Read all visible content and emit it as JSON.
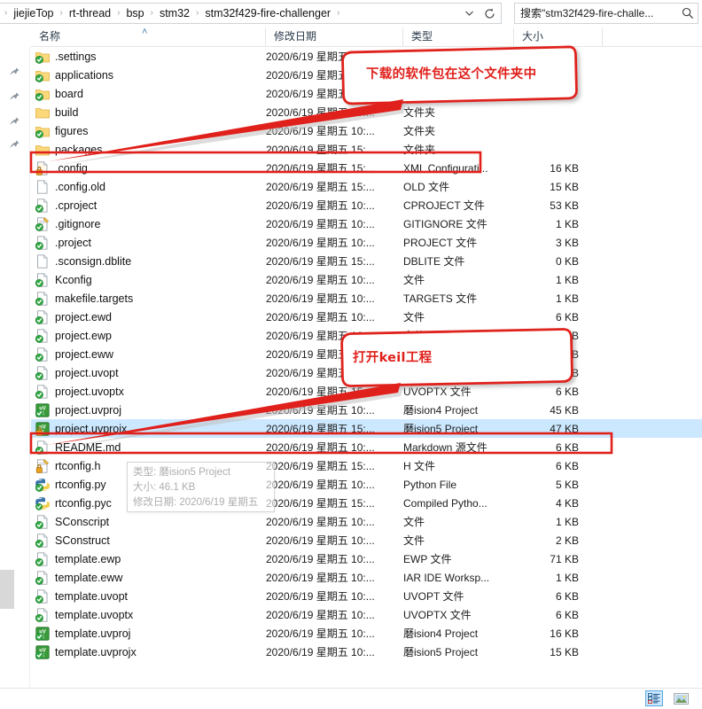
{
  "window": {
    "title": "stm32f429-fire-challenger"
  },
  "address": {
    "breadcrumbs": [
      "jiejieTop",
      "rt-thread",
      "bsp",
      "stm32",
      "stm32f429-fire-challenger"
    ],
    "separator": "›",
    "dropdown_icon": "chevron-down-icon",
    "refresh_icon": "refresh-icon"
  },
  "search": {
    "value": "搜索\"stm32f429-fire-challe...",
    "placeholder": "搜索\"stm32f429-fire-challenger\"",
    "icon": "search-icon"
  },
  "columns": [
    {
      "key": "name",
      "label": "名称",
      "sorted": true,
      "sort_dir": "asc",
      "sort_caret": "˄"
    },
    {
      "key": "date",
      "label": "修改日期",
      "sorted": false,
      "sort_dir": "",
      "sort_caret": ""
    },
    {
      "key": "type",
      "label": "类型",
      "sorted": false,
      "sort_dir": "",
      "sort_caret": ""
    },
    {
      "key": "size",
      "label": "大小",
      "sorted": false,
      "sort_dir": "",
      "sort_caret": ""
    }
  ],
  "nav_pane": {
    "pin_icon": "pin-icon",
    "pin_count": 4
  },
  "files": [
    {
      "name": ".settings",
      "date": "2020/6/19 星期五 10:...",
      "type": "文件夹",
      "size": "",
      "icon": "folder-checked-icon",
      "selected": false
    },
    {
      "name": "applications",
      "date": "2020/6/19 星期五 10:...",
      "type": "文件夹",
      "size": "",
      "icon": "folder-checked-icon",
      "selected": false
    },
    {
      "name": "board",
      "date": "2020/6/19 星期五 10:...",
      "type": "文件夹",
      "size": "",
      "icon": "folder-checked-icon",
      "selected": false
    },
    {
      "name": "build",
      "date": "2020/6/19 星期五 15:...",
      "type": "文件夹",
      "size": "",
      "icon": "folder-icon",
      "selected": false
    },
    {
      "name": "figures",
      "date": "2020/6/19 星期五 10:...",
      "type": "文件夹",
      "size": "",
      "icon": "folder-checked-icon",
      "selected": false
    },
    {
      "name": "packages",
      "date": "2020/6/19 星期五 15:...",
      "type": "文件夹",
      "size": "",
      "icon": "folder-icon",
      "selected": false
    },
    {
      "name": ".config",
      "date": "2020/6/19 星期五 15:...",
      "type": "XML Configurati...",
      "size": "16 KB",
      "icon": "xml-config-icon",
      "selected": false
    },
    {
      "name": ".config.old",
      "date": "2020/6/19 星期五 15:...",
      "type": "OLD 文件",
      "size": "15 KB",
      "icon": "blank-file-icon",
      "selected": false
    },
    {
      "name": ".cproject",
      "date": "2020/6/19 星期五 10:...",
      "type": "CPROJECT 文件",
      "size": "53 KB",
      "icon": "file-checked-icon",
      "selected": false
    },
    {
      "name": ".gitignore",
      "date": "2020/6/19 星期五 10:...",
      "type": "GITIGNORE 文件",
      "size": "1 KB",
      "icon": "notepad-checked-icon",
      "selected": false
    },
    {
      "name": ".project",
      "date": "2020/6/19 星期五 10:...",
      "type": "PROJECT 文件",
      "size": "3 KB",
      "icon": "file-checked-icon",
      "selected": false
    },
    {
      "name": ".sconsign.dblite",
      "date": "2020/6/19 星期五 15:...",
      "type": "DBLITE 文件",
      "size": "0 KB",
      "icon": "blank-file-icon",
      "selected": false
    },
    {
      "name": "Kconfig",
      "date": "2020/6/19 星期五 10:...",
      "type": "文件",
      "size": "1 KB",
      "icon": "file-checked-icon",
      "selected": false
    },
    {
      "name": "makefile.targets",
      "date": "2020/6/19 星期五 10:...",
      "type": "TARGETS 文件",
      "size": "1 KB",
      "icon": "file-checked-icon",
      "selected": false
    },
    {
      "name": "project.ewd",
      "date": "2020/6/19 星期五 10:...",
      "type": "文件",
      "size": "6 KB",
      "icon": "file-checked-icon",
      "selected": false
    },
    {
      "name": "project.ewp",
      "date": "2020/6/19 星期五 10:...",
      "type": "文件",
      "size": "6 KB",
      "icon": "file-checked-icon",
      "selected": false
    },
    {
      "name": "project.eww",
      "date": "2020/6/19 星期五 10:...",
      "type": "文件",
      "size": "6 KB",
      "icon": "file-checked-icon",
      "selected": false
    },
    {
      "name": "project.uvopt",
      "date": "2020/6/19 星期五 10:...",
      "type": "文件",
      "size": "6 KB",
      "icon": "file-checked-icon",
      "selected": false
    },
    {
      "name": "project.uvoptx",
      "date": "2020/6/19 星期五 15:...",
      "type": "UVOPTX 文件",
      "size": "6 KB",
      "icon": "file-checked-icon",
      "selected": false
    },
    {
      "name": "project.uvproj",
      "date": "2020/6/19 星期五 10:...",
      "type": "磿ision4 Project",
      "size": "45 KB",
      "icon": "keil4-checked-icon",
      "selected": false
    },
    {
      "name": "project.uvprojx",
      "date": "2020/6/19 星期五 15:...",
      "type": "磿ision5 Project",
      "size": "47 KB",
      "icon": "keil5-locked-icon",
      "selected": true
    },
    {
      "name": "README.md",
      "date": "2020/6/19 星期五 10:...",
      "type": "Markdown 源文件",
      "size": "6 KB",
      "icon": "file-checked-icon",
      "selected": false
    },
    {
      "name": "rtconfig.h",
      "date": "2020/6/19 星期五 15:...",
      "type": "H 文件",
      "size": "6 KB",
      "icon": "notepad-locked-icon",
      "selected": false
    },
    {
      "name": "rtconfig.py",
      "date": "2020/6/19 星期五 10:...",
      "type": "Python File",
      "size": "5 KB",
      "icon": "python-checked-icon",
      "selected": false
    },
    {
      "name": "rtconfig.pyc",
      "date": "2020/6/19 星期五 15:...",
      "type": "Compiled Pytho...",
      "size": "4 KB",
      "icon": "python-compiled-icon",
      "selected": false
    },
    {
      "name": "SConscript",
      "date": "2020/6/19 星期五 10:...",
      "type": "文件",
      "size": "1 KB",
      "icon": "file-checked-icon",
      "selected": false
    },
    {
      "name": "SConstruct",
      "date": "2020/6/19 星期五 10:...",
      "type": "文件",
      "size": "2 KB",
      "icon": "file-checked-icon",
      "selected": false
    },
    {
      "name": "template.ewp",
      "date": "2020/6/19 星期五 10:...",
      "type": "EWP 文件",
      "size": "71 KB",
      "icon": "file-checked-icon",
      "selected": false
    },
    {
      "name": "template.eww",
      "date": "2020/6/19 星期五 10:...",
      "type": "IAR IDE Worksp...",
      "size": "1 KB",
      "icon": "file-checked-icon",
      "selected": false
    },
    {
      "name": "template.uvopt",
      "date": "2020/6/19 星期五 10:...",
      "type": "UVOPT 文件",
      "size": "6 KB",
      "icon": "file-checked-icon",
      "selected": false
    },
    {
      "name": "template.uvoptx",
      "date": "2020/6/19 星期五 10:...",
      "type": "UVOPTX 文件",
      "size": "6 KB",
      "icon": "file-checked-icon",
      "selected": false
    },
    {
      "name": "template.uvproj",
      "date": "2020/6/19 星期五 10:...",
      "type": "磿ision4 Project",
      "size": "16 KB",
      "icon": "keil4-checked-icon",
      "selected": false
    },
    {
      "name": "template.uvprojx",
      "date": "2020/6/19 星期五 10:...",
      "type": "磿ision5 Project",
      "size": "15 KB",
      "icon": "keil5-checked-icon",
      "selected": false
    }
  ],
  "tooltip": {
    "type_line": "类型: 磿ision5 Project",
    "size_line": "大小: 46.1 KB",
    "date_line": "修改日期: 2020/6/19 星期五"
  },
  "statusbar": {
    "details_view_icon": "details-view-icon",
    "large_icons_view_icon": "large-icons-view-icon",
    "active_view": "details"
  },
  "annotations": {
    "color": "#e0201b",
    "callout1": {
      "text": "下载的软件包在这个文件夹中",
      "target_row": "packages"
    },
    "callout2": {
      "text": "打开keil工程",
      "target_row": "project.uvprojx"
    },
    "highlight_boxes": [
      "packages",
      "project.uvprojx"
    ]
  }
}
